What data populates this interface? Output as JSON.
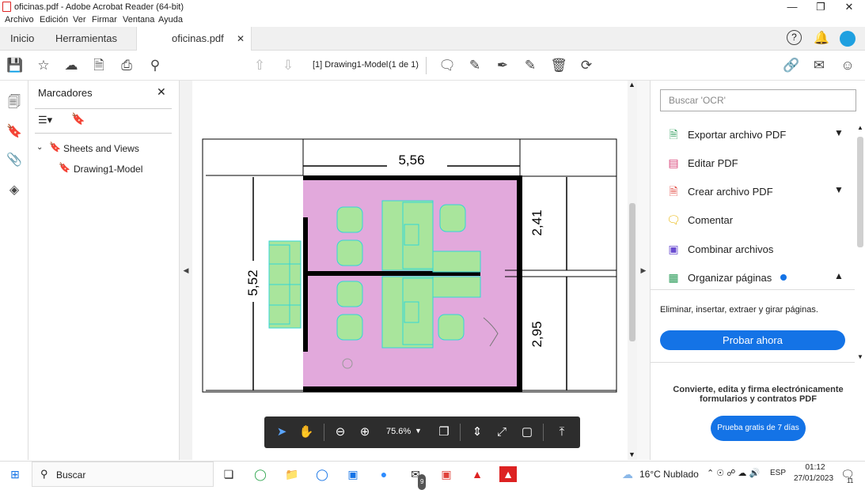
{
  "window": {
    "title": "oficinas.pdf - Adobe Acrobat Reader (64-bit)"
  },
  "menu": [
    "Archivo",
    "Edición",
    "Ver",
    "Firmar",
    "Ventana",
    "Ayuda"
  ],
  "tabs": {
    "home": "Inicio",
    "tools": "Herramientas",
    "doc": "oficinas.pdf"
  },
  "toolbar": {
    "page_label": "[1] Drawing1-Model",
    "page_count": "(1 de 1)"
  },
  "bookmarks": {
    "title": "Marcadores",
    "root": "Sheets and Views",
    "child": "Drawing1-Model"
  },
  "drawing": {
    "dim_top": "5,56",
    "dim_left": "5,52",
    "dim_right_top": "2,41",
    "dim_right_bottom": "2,95"
  },
  "floatbar": {
    "zoom": "75.6%"
  },
  "right": {
    "search_placeholder": "Buscar 'OCR'",
    "tools": [
      "Exportar archivo PDF",
      "Editar PDF",
      "Crear archivo PDF",
      "Comentar",
      "Combinar archivos",
      "Organizar páginas"
    ],
    "organize_desc": "Eliminar, insertar, extraer y girar páginas.",
    "try_now": "Probar ahora",
    "promo": "Convierte, edita y firma electrónicamente formularios y contratos PDF",
    "trial": "Prueba gratis de 7 días"
  },
  "taskbar": {
    "search": "Buscar",
    "weather": "16°C  Nublado",
    "lang": "ESP",
    "time": "01:12",
    "date": "27/01/2023",
    "mail_badge": "9",
    "notif": "11"
  },
  "colors": {
    "accent": "#1473e6",
    "room": "#e2a9dc",
    "furniture": "#a9e59c",
    "furniture_outline": "#33d6d6"
  }
}
